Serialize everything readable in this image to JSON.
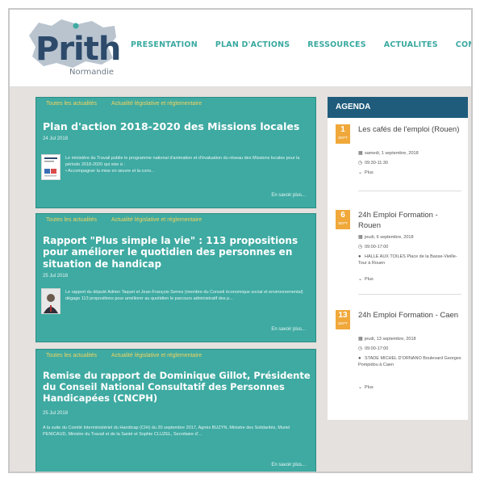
{
  "logo": {
    "text": "Prith",
    "sub": "Normandie"
  },
  "nav": [
    "PRESENTATION",
    "PLAN D'ACTIONS",
    "RESSOURCES",
    "ACTUALITES",
    "CONTACTS"
  ],
  "articles": [
    {
      "tags": [
        "Toutes les actualités",
        "Actualité législative et réglementaire"
      ],
      "title": "Plan d'action 2018-2020 des Missions locales",
      "date": "24 Jul 2018",
      "excerpt": "Le ministère du Travail publie le programme national d'animation et d'évaluation du réseau des Missions locales pour la période 2018-2020 qui vise à :",
      "bullet": "• Accompagner la mise en œuvre et la conv...",
      "more": "En savoir plus..."
    },
    {
      "tags": [
        "Toutes les actualités",
        "Actualité législative et réglementaire"
      ],
      "title": "Rapport \"Plus simple la vie\" : 113 propositions pour améliorer le quotidien des personnes en situation de handicap",
      "date": "25 Jul 2018",
      "excerpt": "Le rapport du député Adrien Taquet et Jean-François Serres (membre du Conseil économique social et environnemental) dégage 113 propositions pour améliorer au quotidien le parcours administratif des p...",
      "more": "En savoir plus..."
    },
    {
      "tags": [
        "Toutes les actualités",
        "Actualité législative et réglementaire"
      ],
      "title": "Remise du rapport de Dominique Gillot, Présidente du Conseil National Consultatif des Personnes Handicapées (CNCPH)",
      "date": "25 Jul 2018",
      "excerpt": "A la suite du Comité Interministériel du Handicap (CIH) du 20 septembre 2017, Agnès BUZYN, Ministre des Solidarités, Muriel PENICAUD, Ministre du Travail et de la Santé et Sophie CLUZEL, Secrétaire d'...",
      "more": "En savoir plus..."
    }
  ],
  "agenda": {
    "title": "AGENDA",
    "events": [
      {
        "day": "1",
        "month": "SEPT",
        "title": "Les cafés de l'emploi (Rouen)",
        "date": "samedi, 1 septembre, 2018",
        "time": "09:30-11:30",
        "place": "",
        "more": "Plus"
      },
      {
        "day": "6",
        "month": "SEPT",
        "title": "24h Emploi Formation - Rouen",
        "date": "jeudi, 6 septembre, 2018",
        "time": "09:00-17:00",
        "place": "HALLE AUX TOILES Place de la Basse-Vieille-Tour à Rouen",
        "more": "Plus"
      },
      {
        "day": "13",
        "month": "SEPT",
        "title": "24h Emploi Formation - Caen",
        "date": "jeudi, 13 septembre, 2018",
        "time": "09:00-17:00",
        "place": "STADE MICHEL D'ORNANO Boulevard Georges Pompidou à Caen",
        "more": "Plus"
      }
    ]
  },
  "colors": {
    "teal": "#3eaaa2",
    "navy": "#1f5c7c",
    "orange": "#f0a83a",
    "tag": "#f4d35e",
    "background": "#e5e1de"
  }
}
